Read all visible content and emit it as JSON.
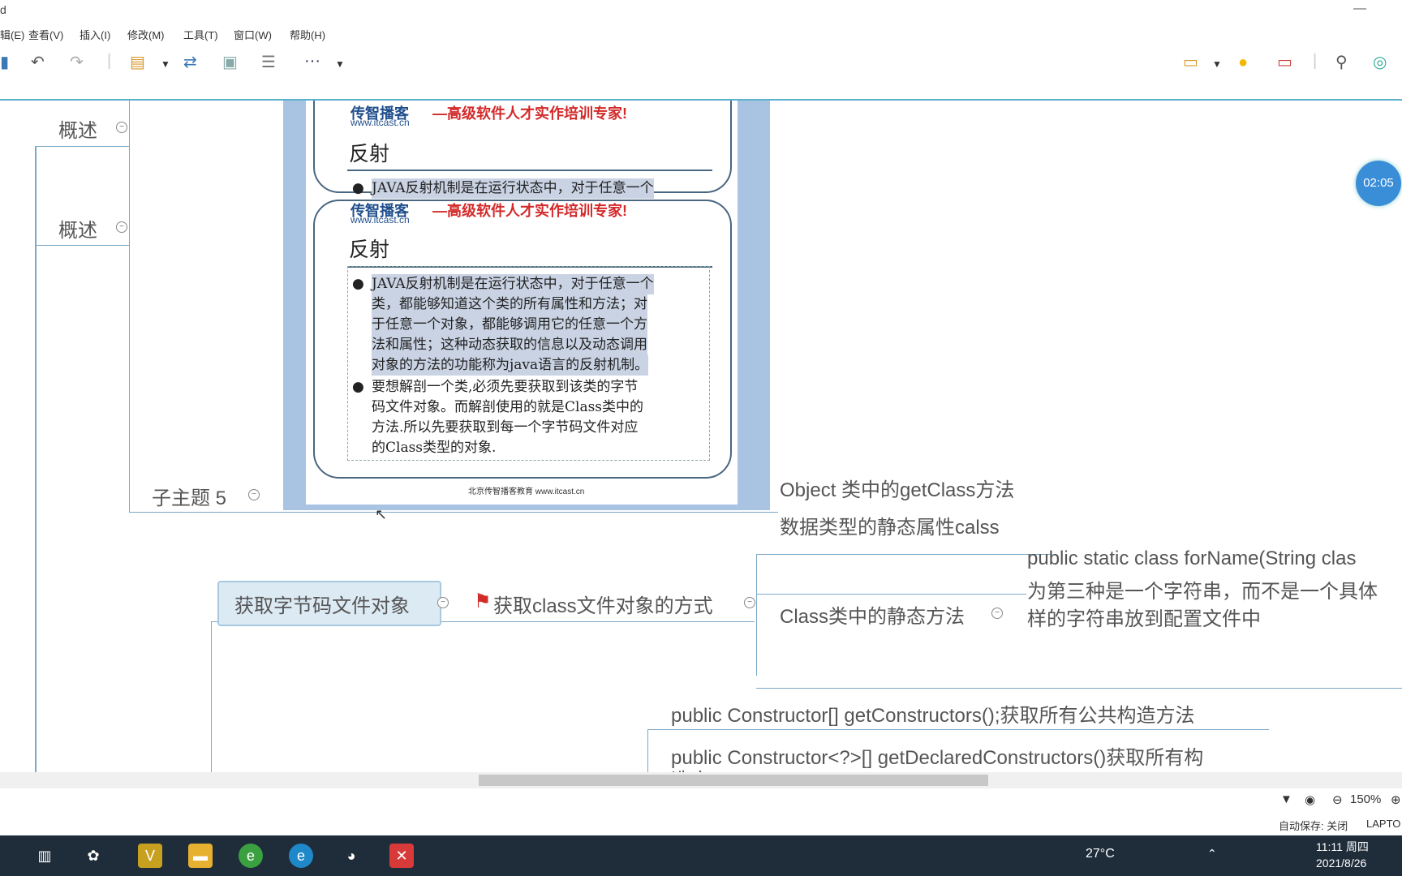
{
  "window": {
    "title": "d"
  },
  "menu": [
    "辑(E)",
    "查看(V)",
    "插入(I)",
    "修改(M)",
    "工具(T)",
    "窗口(W)",
    "帮助(H)"
  ],
  "toolbar": {
    "more_label": "···"
  },
  "timer": "02:05",
  "mindmap": {
    "overview_1": "概述",
    "overview_2": "概述",
    "subtopic_5": "子主题 5",
    "get_bytecode": "获取字节码文件对象",
    "get_class_ways": "获取class文件对象的方式",
    "object_getclass": "Object 类中的getClass方法",
    "static_attr": "数据类型的静态属性calss",
    "class_static": "Class类中的静态方法",
    "forname_1": "public static class forName(String clas",
    "forname_2": "为第三种是一个字符串，而不是一个具体",
    "forname_3": "样的字符串放到配置文件中",
    "constructors": "public Constructor[] getConstructors();获取所有公共构造方法",
    "declared_constructors": "public Constructor<?>[] getDeclaredConstructors()获取所有构",
    "declared_constructors_2": "造方"
  },
  "slide": {
    "logo_cn": "传智播客",
    "slogan": "—高级软件人才实作培训专家!",
    "url": "www.itcast.cn",
    "heading": "反射",
    "bullet1_line1": "JAVA反射机制是在运行状态中，对于任意一个",
    "bullet1_lines": [
      "JAVA反射机制是在运行状态中，对于任意一个",
      "类，都能够知道这个类的所有属性和方法；对",
      "于任意一个对象，都能够调用它的任意一个方",
      "法和属性；这种动态获取的信息以及动态调用",
      "对象的方法的功能称为java语言的反射机制。"
    ],
    "bullet2_lines": [
      "要想解剖一个类,必须先要获取到该类的字节",
      "码文件对象。而解剖使用的就是Class类中的",
      "方法.所以先要获取到每一个字节码文件对应",
      "的Class类型的对象."
    ],
    "footer": "北京传智播客教育 www.itcast.cn"
  },
  "status": {
    "zoom": "150%"
  },
  "autosave": {
    "label": "自动保存: 关闭",
    "machine": "LAPTO"
  },
  "taskbar": {
    "weather": "27°C",
    "time": "11:11 周四",
    "date": "2021/8/26"
  }
}
